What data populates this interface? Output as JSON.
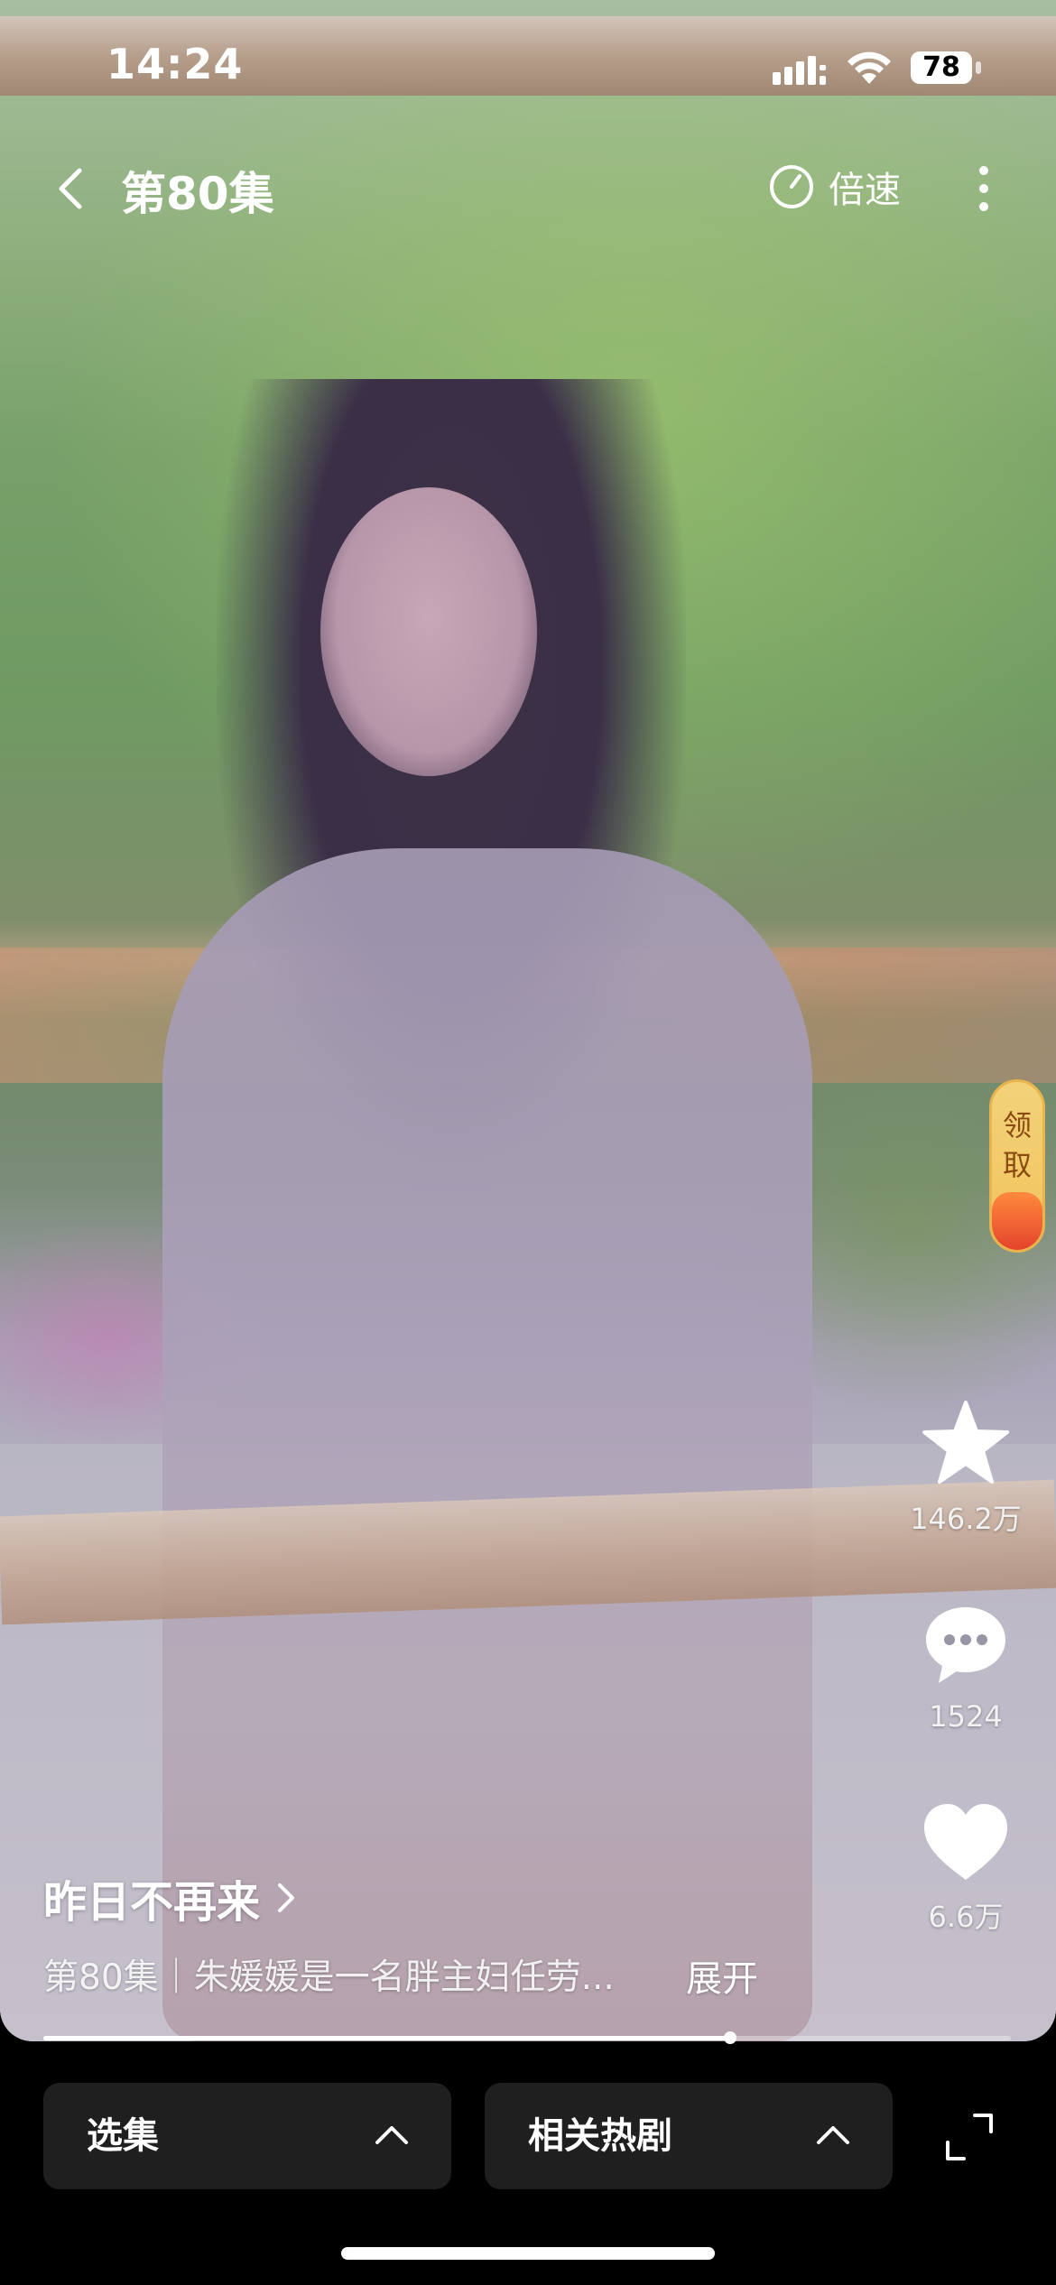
{
  "status_bar": {
    "time": "14:24",
    "battery": "78"
  },
  "header": {
    "title": "第80集",
    "speed_label": "倍速"
  },
  "reward": {
    "text_line1": "领",
    "text_line2": "取"
  },
  "actions": {
    "favorite_count": "146.2万",
    "comment_count": "1524",
    "like_count": "6.6万"
  },
  "drama": {
    "title": "昨日不再来",
    "description": "第80集｜朱媛媛是一名胖主妇任劳...",
    "expand_label": "展开"
  },
  "progress": {
    "value": 0.71
  },
  "bottom": {
    "episodes_label": "选集",
    "related_label": "相关热剧"
  }
}
